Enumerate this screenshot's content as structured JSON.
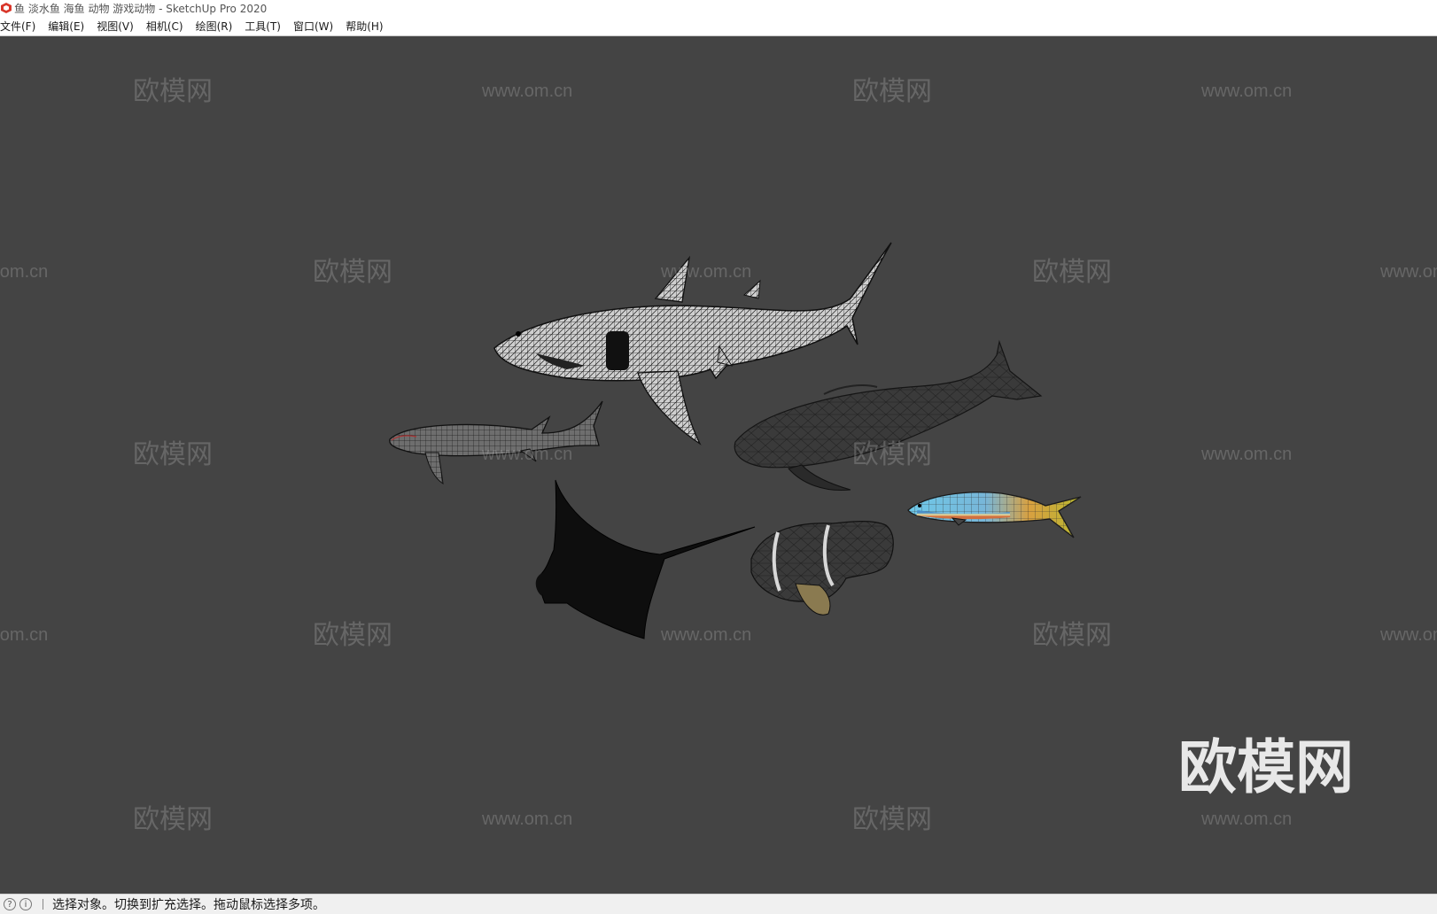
{
  "window": {
    "title": "鱼 淡水鱼 海鱼 动物 游戏动物 - SketchUp Pro 2020",
    "app_icon": "sketchup-logo-icon",
    "accent": "#d9372b"
  },
  "menu": {
    "items": [
      {
        "label": "文件(F)"
      },
      {
        "label": "编辑(E)"
      },
      {
        "label": "视图(V)"
      },
      {
        "label": "相机(C)"
      },
      {
        "label": "绘图(R)"
      },
      {
        "label": "工具(T)"
      },
      {
        "label": "窗口(W)"
      },
      {
        "label": "帮助(H)"
      }
    ]
  },
  "viewport": {
    "background": "#444444",
    "models": [
      "great-white-shark",
      "sperm-whale",
      "whale-shark",
      "manta-ray",
      "clownfish",
      "colorful-fish"
    ]
  },
  "watermark": {
    "logo_text": "欧模网",
    "url_text": "www.om.cn",
    "large_text": "欧模网"
  },
  "status": {
    "icons": [
      "geo-location-icon",
      "info-icon"
    ],
    "text": "选择对象。切换到扩充选择。拖动鼠标选择多项。"
  }
}
